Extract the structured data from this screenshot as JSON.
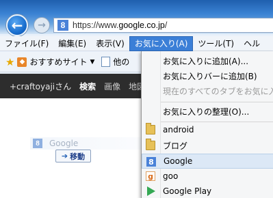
{
  "browser": {
    "url_prefix": "https://www.",
    "url_host": "google.co.jp",
    "url_suffix": "/",
    "back_glyph": "←",
    "forward_glyph": "→",
    "favicon_letter": "8"
  },
  "menubar": {
    "items": [
      {
        "label": "ファイル(F)"
      },
      {
        "label": "編集(E)"
      },
      {
        "label": "表示(V)"
      },
      {
        "label": "お気に入り(A)"
      },
      {
        "label": "ツール(T)"
      },
      {
        "label": "ヘル"
      }
    ]
  },
  "favorites_bar": {
    "recommended": "おすすめサイト",
    "other": "他の"
  },
  "google_bar": {
    "user": "+craftoyajiさん",
    "links": [
      "検索",
      "画像",
      "地図"
    ]
  },
  "search": {
    "label": "Google",
    "go_button": "移動"
  },
  "favorites_menu": {
    "items": [
      {
        "label": "お気に入りに追加(A)...",
        "disabled": false
      },
      {
        "label": "お気に入りバーに追加(B)",
        "disabled": false
      },
      {
        "label": "現在のすべてのタブをお気に入",
        "disabled": true
      },
      {
        "label": "お気に入りの整理(O)...",
        "disabled": false
      }
    ],
    "bookmarks": [
      {
        "label": "android",
        "icon": "folder-icon"
      },
      {
        "label": "ブログ",
        "icon": "folder-icon"
      },
      {
        "label": "Google",
        "icon": "google-icon",
        "favicon_letter": "8"
      },
      {
        "label": "goo",
        "icon": "goo-icon",
        "favicon_letter": "g"
      },
      {
        "label": "Google Play",
        "icon": "google-play-icon"
      }
    ]
  }
}
